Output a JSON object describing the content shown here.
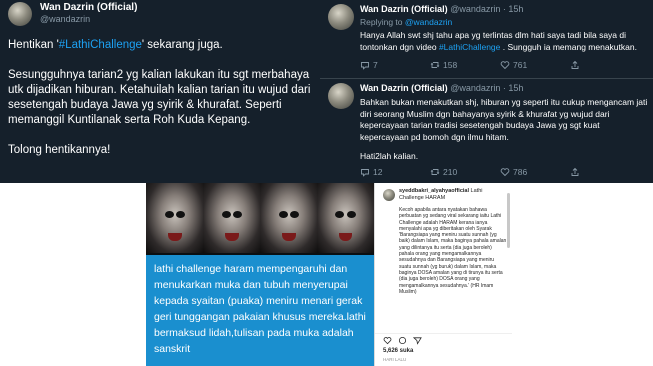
{
  "tweet_left": {
    "name": "Wan Dazrin (Official)",
    "handle": "@wandazrin",
    "line1_pre": "Hentikan '",
    "line1_tag": "#LathiChallenge",
    "line1_post": "' sekarang juga.",
    "paragraph2": "Sesungguhnya tarian2 yg kalian lakukan itu sgt merbahaya utk dijadikan hiburan. Ketahuilah kalian tarian itu wujud dari sesetengah budaya Jawa yg syirik & khurafat. Seperti memanggil Kuntilanak serta Roh Kuda Kepang.",
    "paragraph3": "Tolong hentikannya!"
  },
  "replies": [
    {
      "name": "Wan Dazrin (Official)",
      "handle": "@wandazrin · 15h",
      "replying_label": "Replying to ",
      "replying_to": "@wandazrin",
      "text_pre": "Hanya Allah swt shj tahu apa yg terlintas dlm hati saya tadi bila saya di tontonkan dgn video ",
      "text_tag": "#LathiChallenge",
      "text_post": " . Sungguh ia memang menakutkan.",
      "comments": "7",
      "retweets": "158",
      "likes": "761"
    },
    {
      "name": "Wan Dazrin (Official)",
      "handle": "@wandazrin · 15h",
      "text_main": "Bahkan bukan menakutkan shj, hiburan yg seperti itu cukup mengancam jati diri seorang Muslim dgn bahayanya syirik & khurafat yg wujud dari kepercayaan tarian tradisi sesetengah budaya Jawa yg sgt kuat kepercayaan pd bomoh dgn ilmu hitam.",
      "text_end": "Hati2lah kalian.",
      "comments": "12",
      "retweets": "210",
      "likes": "786"
    }
  ],
  "instagram": {
    "photo_caption": "lathi challenge haram mempengaruhi dan menukarkan muka dan tubuh menyerupai kepada syaitan (puaka) meniru menari gerak geri tunggangan pakaian khusus mereka.lathi bermaksud lidah,tulisan pada muka adalah sanskrit",
    "username": "syeddbakri_alyahyaofficial",
    "user_suffix": " Lathi Challenge HARAM",
    "caption": "Kecoh apabila antara nyatakan bahawa perbuatan yg sedang viral sekarang iaitu Lathi Challenge adalah HARAM kerana ianya menyalahi apa yg diberitakan oleh Syarak 'Barangsiapa yang meniru suatu sunnah (yg baik) dalam Islam, maka baginya pahala amalan yang dilintanya itu serta (dia juga beroleh) pahala orang yang mengamalkannya sesudahnya dan Barangsiapa yang meniru suatu sunnah (yg buruk) dalam Islam, maka baginya DOSA amalan yang di tirunya itu serta (dia juga beroleh) DOSA orang yang mengamalkannya sesudahnya.' (HR Imam Muslim)",
    "likes": "5,626 suka",
    "time": "HARI LALU"
  },
  "colors": {
    "twitter_bg": "#15202b",
    "twitter_link": "#1da1f2",
    "ig_caption_bg": "#1a8fcf"
  }
}
